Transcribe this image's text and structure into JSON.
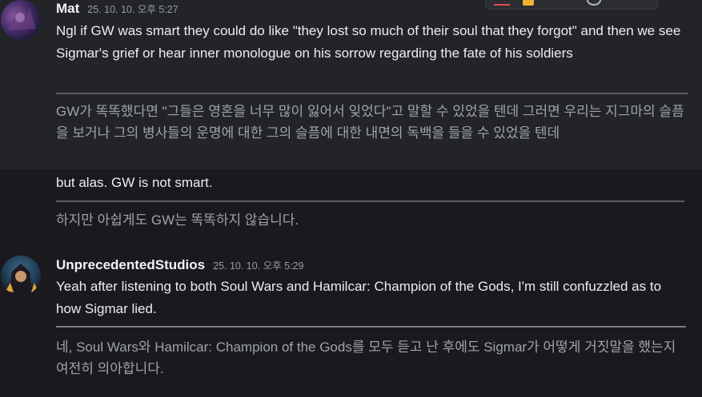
{
  "messages": [
    {
      "author": "Mat",
      "timestamp": "25. 10. 10. 오후 5:27",
      "content": "Ngl if GW was smart they could do like \"they lost so much of their soul that they forgot\" and then we see Sigmar's grief or hear inner monologue on his sorrow regarding the fate of his soldiers",
      "translation": "GW가 똑똑했다면 \"그들은 영혼을 너무 많이 잃어서 잊었다\"고 말할 수 있었을 텐데 그러면 우리는 지그마의 슬픔을 보거나 그의 병사들의 운명에 대한 그의 슬픔에 대한 내면의 독백을 들을 수 있었을 텐데",
      "followup": {
        "content": "but alas. GW is not smart.",
        "translation": "하지만 아쉽게도 GW는 똑똑하지 않습니다."
      }
    },
    {
      "author": "UnprecedentedStudios",
      "timestamp": "25. 10. 10. 오후 5:29",
      "content": "Yeah after listening to both Soul Wars and Hamilcar: Champion of the Gods, I'm still confuzzled as to how Sigmar lied.",
      "translation": "네, Soul Wars와 Hamilcar: Champion of the Gods를 모두 듣고 난 후에도 Sigmar가 어떻게 거짓말을 했는지 여전히 의아합니다."
    }
  ],
  "icons": {
    "toolbar": [
      "reaction-icon",
      "emoji-icon",
      "more-icon"
    ]
  },
  "colors": {
    "background": "#1a1a1e",
    "hover_background": "#232428",
    "author": "#f2f3f5",
    "timestamp": "#949ba4",
    "message": "#ebedef",
    "translation": "#9ea3ab"
  }
}
